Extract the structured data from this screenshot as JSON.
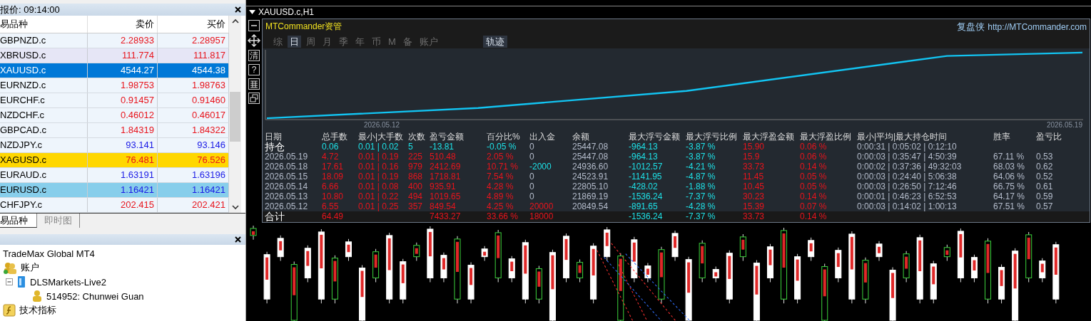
{
  "market_watch": {
    "title": "报价: 09:14:00",
    "columns": [
      "易品种",
      "卖价",
      "买价"
    ],
    "rows": [
      {
        "symbol": "GBPNZD.c",
        "bid": "2.28933",
        "ask": "2.28957",
        "rising": false,
        "selected": false,
        "color": "#eef5fc"
      },
      {
        "symbol": "XBRUSD.c",
        "bid": "111.774",
        "ask": "111.817",
        "rising": false,
        "selected": false,
        "color": "#e6e6f6"
      },
      {
        "symbol": "XAUUSD.c",
        "bid": "4544.27",
        "ask": "4544.38",
        "selected": true,
        "color": "#0078d7"
      },
      {
        "symbol": "EURNZD.c",
        "bid": "1.98753",
        "ask": "1.98763",
        "rising": false,
        "selected": false,
        "color": "#eef5fc"
      },
      {
        "symbol": "EURCHF.c",
        "bid": "0.91457",
        "ask": "0.91460",
        "rising": false,
        "selected": false,
        "color": "#eef5fc"
      },
      {
        "symbol": "NZDCHF.c",
        "bid": "0.46012",
        "ask": "0.46017",
        "rising": false,
        "selected": false,
        "color": "#eef5fc"
      },
      {
        "symbol": "GBPCAD.c",
        "bid": "1.84319",
        "ask": "1.84322",
        "rising": false,
        "selected": false,
        "color": "#eef5fc"
      },
      {
        "symbol": "NZDJPY.c",
        "bid": "93.141",
        "ask": "93.146",
        "rising": true,
        "selected": false,
        "color": "#eef5fc"
      },
      {
        "symbol": "XAGUSD.c",
        "bid": "76.481",
        "ask": "76.526",
        "rising": false,
        "selected": false,
        "color": "#ffd700"
      },
      {
        "symbol": "EURAUD.c",
        "bid": "1.63191",
        "ask": "1.63196",
        "rising": true,
        "selected": false,
        "color": "#eef5fc"
      },
      {
        "symbol": "EURUSD.c",
        "bid": "1.16421",
        "ask": "1.16421",
        "rising": true,
        "selected": false,
        "color": "#87ceeb"
      },
      {
        "symbol": "CHFJPY.c",
        "bid": "202.415",
        "ask": "202.421",
        "rising": false,
        "selected": false,
        "color": "#eef5fc"
      }
    ],
    "tabs": [
      {
        "label": "易品种",
        "selected": true
      },
      {
        "label": "即时图",
        "selected": false
      }
    ]
  },
  "navigator": {
    "tree": [
      {
        "label": "TradeMax Global MT4",
        "kind": "root"
      },
      {
        "label": "账户",
        "kind": "accounts",
        "children": [
          {
            "label": "DLSMarkets-Live2",
            "kind": "server",
            "expanded": true,
            "children": [
              {
                "label": "514952: Chunwei Guan",
                "kind": "user"
              }
            ]
          }
        ]
      },
      {
        "label": "技术指标",
        "kind": "indicators"
      }
    ]
  },
  "chart_window": {
    "title": "XAUUSD.c,H1"
  },
  "side_tools": [
    "清",
    "?"
  ],
  "panel": {
    "title": "MTCommander资管",
    "brand": "复盘侠",
    "link": "http://MTCommander.com",
    "tabs": [
      {
        "label": "综",
        "selected": false
      },
      {
        "label": "日",
        "selected": true
      },
      {
        "label": "周",
        "selected": false
      },
      {
        "label": "月",
        "selected": false
      },
      {
        "label": "季",
        "selected": false
      },
      {
        "label": "年",
        "selected": false
      },
      {
        "label": "币",
        "selected": false
      },
      {
        "label": "M",
        "selected": false
      },
      {
        "label": "备",
        "selected": false
      },
      {
        "label": "账户",
        "selected": false
      }
    ],
    "track_button": "轨迹",
    "curve_dates": [
      "2026.05.12",
      "2026.05.19"
    ],
    "columns": [
      "日期",
      "总手数",
      "最小|大手数",
      "次数",
      "盈亏金额",
      "百分比%",
      "出入金",
      "余额",
      "最大浮亏金额",
      "最大浮亏比例",
      "最大浮盈金额",
      "最大浮盈比例",
      "最小|平均|最大持仓时间",
      "胜率",
      "盈亏比"
    ],
    "rows": [
      {
        "kind": "position",
        "cells": [
          {
            "text": "持仓",
            "color": "#ffffff"
          },
          {
            "text": "0.06",
            "color": "#1ee0e6"
          },
          {
            "text": "0.01 | 0.02",
            "color": "#1ee0e6"
          },
          {
            "text": "5",
            "color": "#1ee0e6"
          },
          {
            "text": "-13.81",
            "color": "#1ee0e6"
          },
          {
            "text": "-0.05 %",
            "color": "#1ee0e6"
          },
          {
            "text": "0",
            "color": "#b4bccb"
          },
          {
            "text": "25447.08",
            "color": "#b4bccb"
          },
          {
            "text": "-964.13",
            "color": "#1ee0e6"
          },
          {
            "text": "-3.87 %",
            "color": "#1ee0e6"
          },
          {
            "text": "15.90",
            "color": "#e8141c"
          },
          {
            "text": "0.06 %",
            "color": "#e8141c"
          },
          {
            "text": "0:00:31 | 0:05:02 | 0:12:10",
            "color": "#b4bccb"
          },
          null,
          null
        ]
      },
      {
        "kind": "day",
        "cells": [
          {
            "text": "2026.05.19",
            "color": "#b4bccb"
          },
          {
            "text": "4.72",
            "color": "#e8141c"
          },
          {
            "text": "0.01 | 0.19",
            "color": "#e8141c"
          },
          {
            "text": "225",
            "color": "#e8141c"
          },
          {
            "text": "510.48",
            "color": "#e8141c"
          },
          {
            "text": "2.05 %",
            "color": "#e8141c"
          },
          {
            "text": "0",
            "color": "#b4bccb"
          },
          {
            "text": "25447.08",
            "color": "#b4bccb"
          },
          {
            "text": "-964.13",
            "color": "#1ee0e6"
          },
          {
            "text": "-3.87 %",
            "color": "#1ee0e6"
          },
          {
            "text": "15.9",
            "color": "#e8141c"
          },
          {
            "text": "0.06 %",
            "color": "#e8141c"
          },
          {
            "text": "0:00:03 | 0:35:47 | 4:50:39",
            "color": "#b4bccb"
          },
          {
            "text": "67.11 %",
            "color": "#b4bccb"
          },
          {
            "text": "0.53",
            "color": "#b4bccb"
          }
        ]
      },
      {
        "kind": "day",
        "cells": [
          {
            "text": "2026.05.18",
            "color": "#b4bccb"
          },
          {
            "text": "17.61",
            "color": "#e8141c"
          },
          {
            "text": "0.01 | 0.16",
            "color": "#e8141c"
          },
          {
            "text": "979",
            "color": "#e8141c"
          },
          {
            "text": "2412.69",
            "color": "#e8141c"
          },
          {
            "text": "10.71 %",
            "color": "#e8141c"
          },
          {
            "text": "-2000",
            "color": "#1ee0e6"
          },
          {
            "text": "24936.60",
            "color": "#b4bccb"
          },
          {
            "text": "-1012.57",
            "color": "#1ee0e6"
          },
          {
            "text": "-4.21 %",
            "color": "#1ee0e6"
          },
          {
            "text": "33.73",
            "color": "#e8141c"
          },
          {
            "text": "0.14 %",
            "color": "#e8141c"
          },
          {
            "text": "0:00:02 | 0:37:36 | 49:32:03",
            "color": "#b4bccb"
          },
          {
            "text": "68.03 %",
            "color": "#b4bccb"
          },
          {
            "text": "0.62",
            "color": "#b4bccb"
          }
        ]
      },
      {
        "kind": "day",
        "cells": [
          {
            "text": "2026.05.15",
            "color": "#b4bccb"
          },
          {
            "text": "18.09",
            "color": "#e8141c"
          },
          {
            "text": "0.01 | 0.19",
            "color": "#e8141c"
          },
          {
            "text": "868",
            "color": "#e8141c"
          },
          {
            "text": "1718.81",
            "color": "#e8141c"
          },
          {
            "text": "7.54 %",
            "color": "#e8141c"
          },
          {
            "text": "0",
            "color": "#b4bccb"
          },
          {
            "text": "24523.91",
            "color": "#b4bccb"
          },
          {
            "text": "-1141.95",
            "color": "#1ee0e6"
          },
          {
            "text": "-4.87 %",
            "color": "#1ee0e6"
          },
          {
            "text": "11.45",
            "color": "#e8141c"
          },
          {
            "text": "0.05 %",
            "color": "#e8141c"
          },
          {
            "text": "0:00:03 | 0:24:40 | 5:06:38",
            "color": "#b4bccb"
          },
          {
            "text": "64.06 %",
            "color": "#b4bccb"
          },
          {
            "text": "0.52",
            "color": "#b4bccb"
          }
        ]
      },
      {
        "kind": "day",
        "cells": [
          {
            "text": "2026.05.14",
            "color": "#b4bccb"
          },
          {
            "text": "6.66",
            "color": "#e8141c"
          },
          {
            "text": "0.01 | 0.08",
            "color": "#e8141c"
          },
          {
            "text": "400",
            "color": "#e8141c"
          },
          {
            "text": "935.91",
            "color": "#e8141c"
          },
          {
            "text": "4.28 %",
            "color": "#e8141c"
          },
          {
            "text": "0",
            "color": "#b4bccb"
          },
          {
            "text": "22805.10",
            "color": "#b4bccb"
          },
          {
            "text": "-428.02",
            "color": "#1ee0e6"
          },
          {
            "text": "-1.88 %",
            "color": "#1ee0e6"
          },
          {
            "text": "10.45",
            "color": "#e8141c"
          },
          {
            "text": "0.05 %",
            "color": "#e8141c"
          },
          {
            "text": "0:00:03 | 0:26:50 | 7:12:46",
            "color": "#b4bccb"
          },
          {
            "text": "66.75 %",
            "color": "#b4bccb"
          },
          {
            "text": "0.61",
            "color": "#b4bccb"
          }
        ]
      },
      {
        "kind": "day",
        "cells": [
          {
            "text": "2026.05.13",
            "color": "#b4bccb"
          },
          {
            "text": "10.80",
            "color": "#e8141c"
          },
          {
            "text": "0.01 | 0.22",
            "color": "#e8141c"
          },
          {
            "text": "494",
            "color": "#e8141c"
          },
          {
            "text": "1019.65",
            "color": "#e8141c"
          },
          {
            "text": "4.89 %",
            "color": "#e8141c"
          },
          {
            "text": "0",
            "color": "#b4bccb"
          },
          {
            "text": "21869.19",
            "color": "#b4bccb"
          },
          {
            "text": "-1536.24",
            "color": "#1ee0e6"
          },
          {
            "text": "-7.37 %",
            "color": "#1ee0e6"
          },
          {
            "text": "30.23",
            "color": "#e8141c"
          },
          {
            "text": "0.14 %",
            "color": "#e8141c"
          },
          {
            "text": "0:00:01 | 0:46:23 | 6:52:53",
            "color": "#b4bccb"
          },
          {
            "text": "64.17 %",
            "color": "#b4bccb"
          },
          {
            "text": "0.59",
            "color": "#b4bccb"
          }
        ]
      },
      {
        "kind": "day",
        "cells": [
          {
            "text": "2026.05.12",
            "color": "#b4bccb"
          },
          {
            "text": "6.55",
            "color": "#e8141c"
          },
          {
            "text": "0.01 | 0.25",
            "color": "#e8141c"
          },
          {
            "text": "357",
            "color": "#e8141c"
          },
          {
            "text": "849.54",
            "color": "#e8141c"
          },
          {
            "text": "4.25 %",
            "color": "#e8141c"
          },
          {
            "text": "20000",
            "color": "#e8141c"
          },
          {
            "text": "20849.54",
            "color": "#b4bccb"
          },
          {
            "text": "-891.65",
            "color": "#1ee0e6"
          },
          {
            "text": "-4.28 %",
            "color": "#1ee0e6"
          },
          {
            "text": "15.39",
            "color": "#e8141c"
          },
          {
            "text": "0.07 %",
            "color": "#e8141c"
          },
          {
            "text": "0:00:03 | 0:14:02 | 1:00:13",
            "color": "#b4bccb"
          },
          {
            "text": "67.51 %",
            "color": "#b4bccb"
          },
          {
            "text": "0.57",
            "color": "#b4bccb"
          }
        ]
      },
      {
        "kind": "total",
        "cells": [
          {
            "text": "合计",
            "color": "#ffffff"
          },
          {
            "text": "64.49",
            "color": "#e8141c"
          },
          null,
          null,
          {
            "text": "7433.27",
            "color": "#e8141c"
          },
          {
            "text": "33.66 %",
            "color": "#e8141c"
          },
          {
            "text": "18000",
            "color": "#e8141c"
          },
          null,
          {
            "text": "-1536.24",
            "color": "#1ee0e6"
          },
          {
            "text": "-7.37 %",
            "color": "#1ee0e6"
          },
          {
            "text": "33.73",
            "color": "#e8141c"
          },
          {
            "text": "0.14 %",
            "color": "#e8141c"
          },
          null,
          null,
          null
        ]
      }
    ]
  }
}
